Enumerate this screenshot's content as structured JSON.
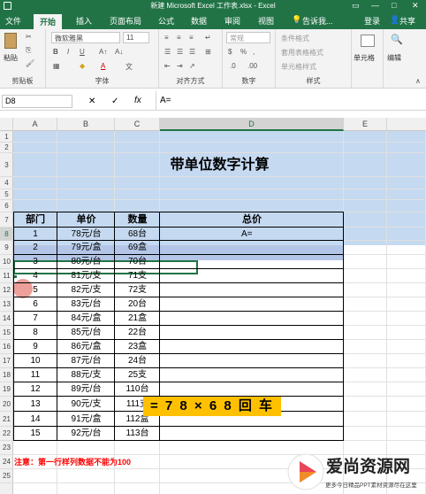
{
  "titlebar": {
    "title": "新建 Microsoft Excel 工作表.xlsx - Excel",
    "restore": "▭",
    "minimize": "—",
    "maximize": "□",
    "close": "✕"
  },
  "tabs": {
    "file": "文件",
    "home": "开始",
    "insert": "插入",
    "layout": "页面布局",
    "formulas": "公式",
    "data": "数据",
    "review": "审阅",
    "view": "视图",
    "tell": "告诉我...",
    "login": "登录",
    "share": "共享"
  },
  "ribbon": {
    "paste": "粘贴",
    "clipboard": "剪贴板",
    "font_name": "微软雅黑",
    "font_size": "11",
    "font_group": "字体",
    "align_group": "对齐方式",
    "number_format": "常规",
    "number_group": "数字",
    "style_group": "样式",
    "cond_format": "条件格式",
    "table_format": "套用表格格式",
    "cell_style": "单元格样式",
    "cells": "单元格",
    "edit": "编辑",
    "bold": "B",
    "italic": "I",
    "underline": "U",
    "font_color": "A",
    "percent": "%",
    "comma": ",",
    "dec_inc": ".0",
    "dec_dec": ".00"
  },
  "formula_bar": {
    "name_box": "D8",
    "cancel": "✕",
    "enter": "✓",
    "fx": "fx",
    "content": "A="
  },
  "columns": [
    "A",
    "B",
    "C",
    "D",
    "E"
  ],
  "rows": [
    "1",
    "2",
    "3",
    "4",
    "5",
    "6",
    "7",
    "8",
    "9",
    "10",
    "11",
    "12",
    "13",
    "14",
    "15",
    "16",
    "17",
    "18",
    "19",
    "20",
    "21",
    "22",
    "23",
    "24",
    "25"
  ],
  "sheet": {
    "title": "带单位数字计算",
    "headers": [
      "部门",
      "单价",
      "数量",
      "总价"
    ],
    "data": [
      [
        "1",
        "78元/台",
        "68台"
      ],
      [
        "2",
        "79元/盒",
        "69盒"
      ],
      [
        "3",
        "80元/台",
        "70台"
      ],
      [
        "4",
        "81元/支",
        "71支"
      ],
      [
        "5",
        "82元/支",
        "72支"
      ],
      [
        "6",
        "83元/台",
        "20台"
      ],
      [
        "7",
        "84元/盒",
        "21盒"
      ],
      [
        "8",
        "85元/台",
        "22台"
      ],
      [
        "9",
        "86元/盒",
        "23盒"
      ],
      [
        "10",
        "87元/台",
        "24台"
      ],
      [
        "11",
        "88元/支",
        "25支"
      ],
      [
        "12",
        "89元/台",
        "110台"
      ],
      [
        "13",
        "90元/支",
        "111支"
      ],
      [
        "14",
        "91元/盒",
        "112盒"
      ],
      [
        "15",
        "92元/台",
        "113台"
      ]
    ],
    "active_entry": "A=",
    "note": "注意：第一行样列数据不能为100"
  },
  "subtitle": "= 7 8 × 6 8 回 车",
  "watermark": {
    "title": "爱尚资源网",
    "sub": "更多今日精品PPT素材资源尽在这里"
  },
  "colors": {
    "excel_green": "#217346",
    "title_band": "#c5d9f1",
    "header_fill": "#b4c6e7",
    "note_red": "#ff0000",
    "subtitle_bg": "#ffc000"
  }
}
